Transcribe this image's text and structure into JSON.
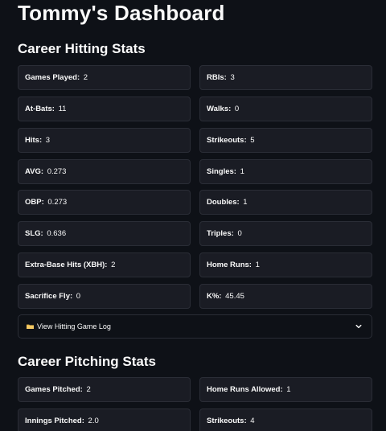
{
  "title": "Tommy's Dashboard",
  "hitting": {
    "header": "Career Hitting Stats",
    "left": [
      {
        "label": "Games Played:",
        "value": "2"
      },
      {
        "label": "At-Bats:",
        "value": "11"
      },
      {
        "label": "Hits:",
        "value": "3"
      },
      {
        "label": "AVG:",
        "value": "0.273"
      },
      {
        "label": "OBP:",
        "value": "0.273"
      },
      {
        "label": "SLG:",
        "value": "0.636"
      },
      {
        "label": "Extra-Base Hits (XBH):",
        "value": "2"
      },
      {
        "label": "Sacrifice Fly:",
        "value": "0"
      }
    ],
    "right": [
      {
        "label": "RBIs:",
        "value": "3"
      },
      {
        "label": "Walks:",
        "value": "0"
      },
      {
        "label": "Strikeouts:",
        "value": "5"
      },
      {
        "label": "Singles:",
        "value": "1"
      },
      {
        "label": "Doubles:",
        "value": "1"
      },
      {
        "label": "Triples:",
        "value": "0"
      },
      {
        "label": "Home Runs:",
        "value": "1"
      },
      {
        "label": "K%:",
        "value": "45.45"
      }
    ],
    "expander_label": "View Hitting Game Log"
  },
  "pitching": {
    "header": "Career Pitching Stats",
    "left": [
      {
        "label": "Games Pitched:",
        "value": "2"
      },
      {
        "label": "Innings Pitched:",
        "value": "2.0"
      }
    ],
    "right": [
      {
        "label": "Home Runs Allowed:",
        "value": "1"
      },
      {
        "label": "Strikeouts:",
        "value": "4"
      }
    ]
  },
  "icons": {
    "expander_icon": "folder-icon",
    "expander_toggle": "chevron-down-icon"
  },
  "colors": {
    "background": "#0e1117",
    "card_background": "#1a1c24",
    "card_border": "#2a2d36",
    "text": "#fafafa",
    "folder": "#e8b84a"
  }
}
